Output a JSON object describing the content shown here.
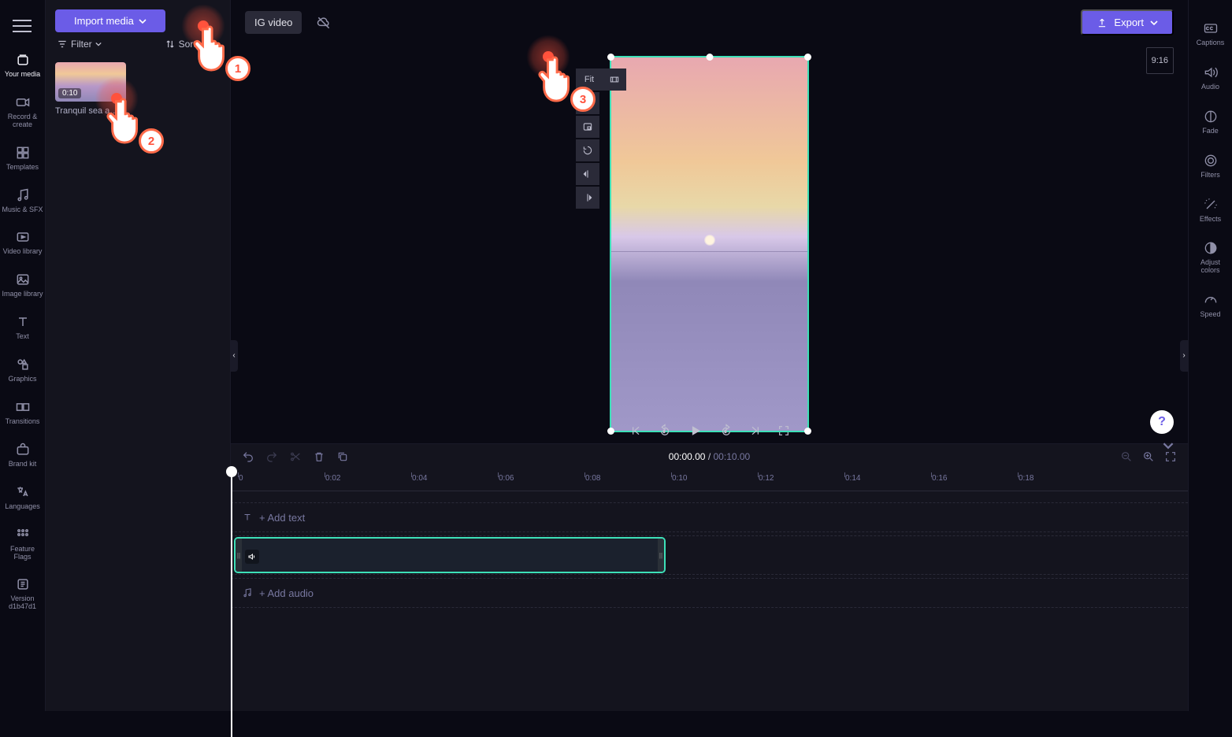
{
  "header": {
    "import_label": "Import media",
    "preset_label": "IG video",
    "export_label": "Export",
    "aspect_ratio": "9:16"
  },
  "filter_bar": {
    "filter_label": "Filter",
    "sort_label": "Sort"
  },
  "left_rail": {
    "items": [
      {
        "label": "Your media",
        "icon": "media-stack-icon",
        "active": true
      },
      {
        "label": "Record & create",
        "icon": "camera-icon"
      },
      {
        "label": "Templates",
        "icon": "templates-icon"
      },
      {
        "label": "Music & SFX",
        "icon": "music-icon"
      },
      {
        "label": "Video library",
        "icon": "video-icon"
      },
      {
        "label": "Image library",
        "icon": "image-icon"
      },
      {
        "label": "Text",
        "icon": "text-icon"
      },
      {
        "label": "Graphics",
        "icon": "graphics-icon"
      },
      {
        "label": "Transitions",
        "icon": "transitions-icon"
      },
      {
        "label": "Brand kit",
        "icon": "brandkit-icon"
      },
      {
        "label": "Languages",
        "icon": "languages-icon"
      },
      {
        "label": "Feature Flags",
        "icon": "flags-icon"
      },
      {
        "label": "Version d1b47d1",
        "icon": "version-icon"
      }
    ]
  },
  "media_panel": {
    "thumbs": [
      {
        "duration": "0:10",
        "name": "Tranquil sea a…"
      }
    ]
  },
  "float_tools": {
    "fit_label": "Fit"
  },
  "playback": {
    "current": "00:00.00",
    "separator": " / ",
    "total": "00:10.00"
  },
  "ruler": {
    "ticks": [
      "0",
      "0:02",
      "0:04",
      "0:06",
      "0:08",
      "0:10",
      "0:12",
      "0:14",
      "0:16",
      "0:18"
    ]
  },
  "tracks": {
    "text_placeholder": "+ Add text",
    "audio_placeholder": "+ Add audio"
  },
  "right_rail": {
    "items": [
      {
        "label": "Captions",
        "icon": "cc-icon"
      },
      {
        "label": "Audio",
        "icon": "speaker-icon"
      },
      {
        "label": "Fade",
        "icon": "fade-icon"
      },
      {
        "label": "Filters",
        "icon": "filters-circle-icon"
      },
      {
        "label": "Effects",
        "icon": "wand-icon"
      },
      {
        "label": "Adjust colors",
        "icon": "contrast-icon"
      },
      {
        "label": "Speed",
        "icon": "gauge-icon"
      }
    ]
  },
  "steps": {
    "s1": "1",
    "s2": "2",
    "s3": "3"
  },
  "help": "?"
}
